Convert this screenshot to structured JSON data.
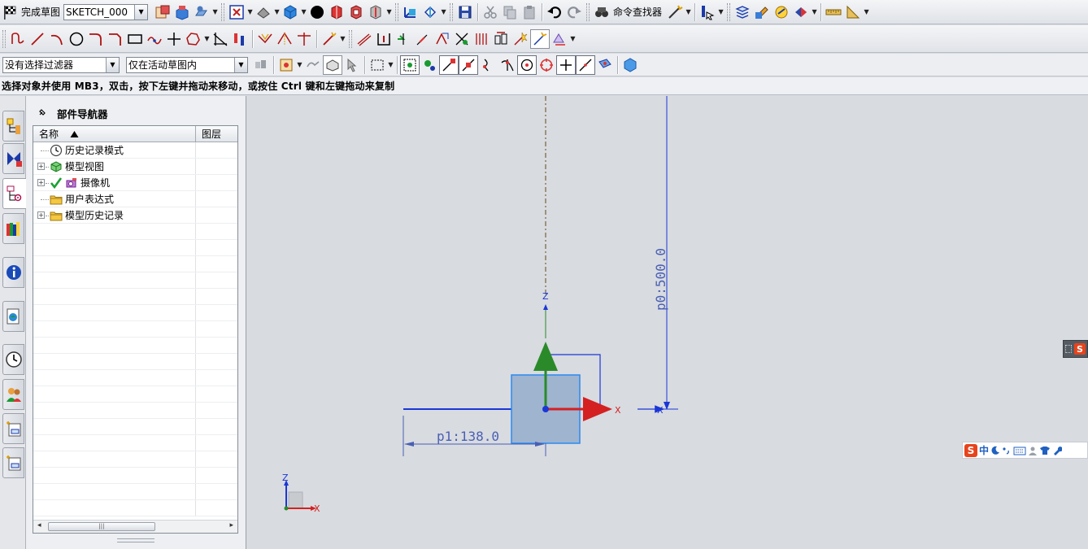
{
  "toolbar_top": {
    "finish_sketch_label": "完成草图",
    "sketch_name": "SKETCH_000",
    "command_finder_label": "命令查找器"
  },
  "filter_bar": {
    "selection_filter": "没有选择过滤器",
    "scope": "仅在活动草图内"
  },
  "hint": "选择对象并使用 MB3，双击，按下左键并拖动来移动，或按住 Ctrl 键和左键拖动来复制",
  "navigator": {
    "title": "部件导航器",
    "columns": [
      "名称",
      "图层"
    ],
    "items": [
      {
        "label": "历史记录模式",
        "icon": "clock-icon",
        "expandable": false
      },
      {
        "label": "模型视图",
        "icon": "model-views-icon",
        "expandable": true
      },
      {
        "label": "摄像机",
        "icon": "camera-icon",
        "expandable": true,
        "checked": true
      },
      {
        "label": "用户表达式",
        "icon": "folder-icon",
        "expandable": false
      },
      {
        "label": "模型历史记录",
        "icon": "folder-icon",
        "expandable": true
      }
    ]
  },
  "graphics": {
    "vertical_dimension": "p0:500.0",
    "horizontal_dimension": "p1:138.0",
    "axis_z": "Z",
    "axis_x": "X",
    "triad_z": "Z",
    "triad_x": "X",
    "csys_x": "X"
  },
  "ime": {
    "logo": "S",
    "mode": "中"
  },
  "colors": {
    "accent_blue": "#1a37d6",
    "dimension_blue": "#4a5fb3",
    "x_axis_red": "#d42020",
    "z_axis_green": "#2a8a2a",
    "shaded_rect": "#9fb4cf"
  }
}
